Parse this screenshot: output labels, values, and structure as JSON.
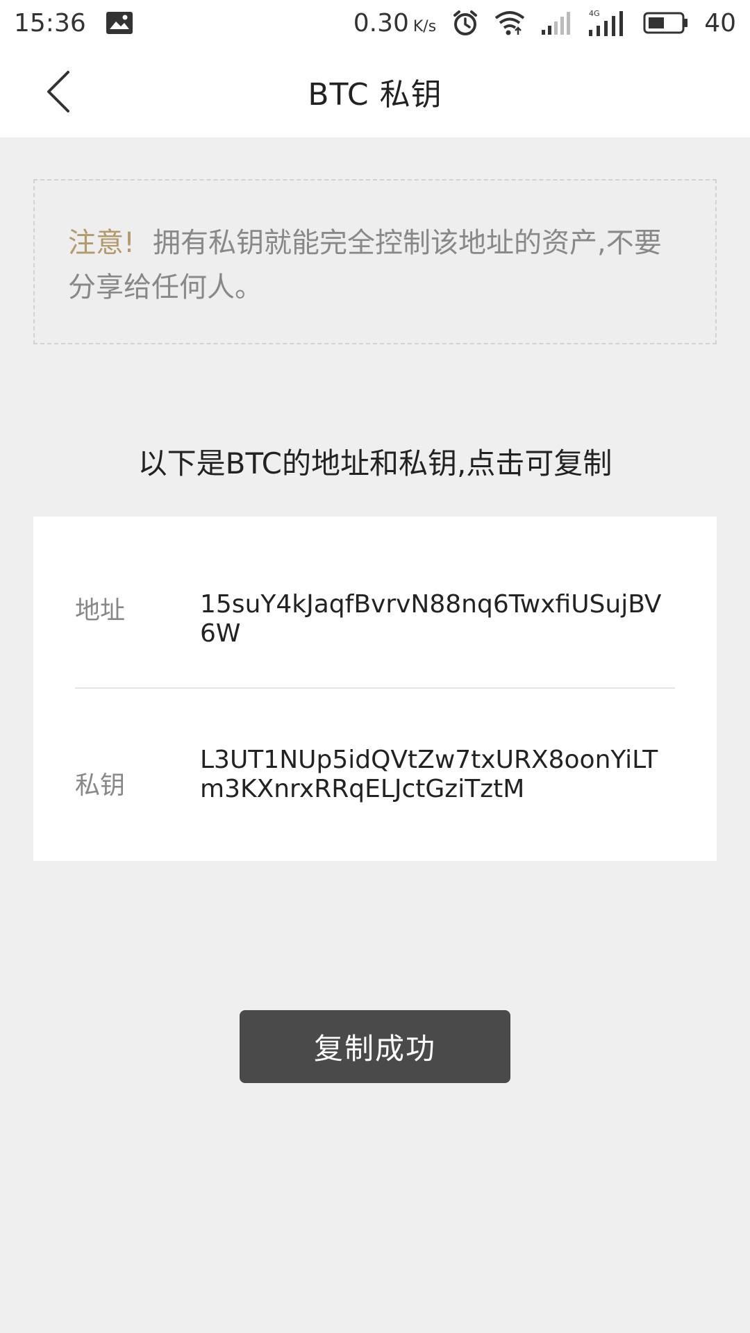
{
  "status_bar": {
    "time": "15:36",
    "net_speed": "0.30",
    "net_speed_unit": "K/s",
    "network_type": "4G",
    "battery": "40"
  },
  "header": {
    "title": "BTC 私钥"
  },
  "notice": {
    "warning": "注意!",
    "message": "拥有私钥就能完全控制该地址的资产,不要分享给任何人。"
  },
  "instruction": "以下是BTC的地址和私钥,点击可复制",
  "address": {
    "label": "地址",
    "value": "15suY4kJaqfBvrvN88nq6TwxfiUSujBV6W"
  },
  "private_key": {
    "label": "私钥",
    "value": "L3UT1NUp5idQVtZw7txURX8oonYiLTm3KXnrxRRqELJctGziTztM"
  },
  "toast": "复制成功"
}
